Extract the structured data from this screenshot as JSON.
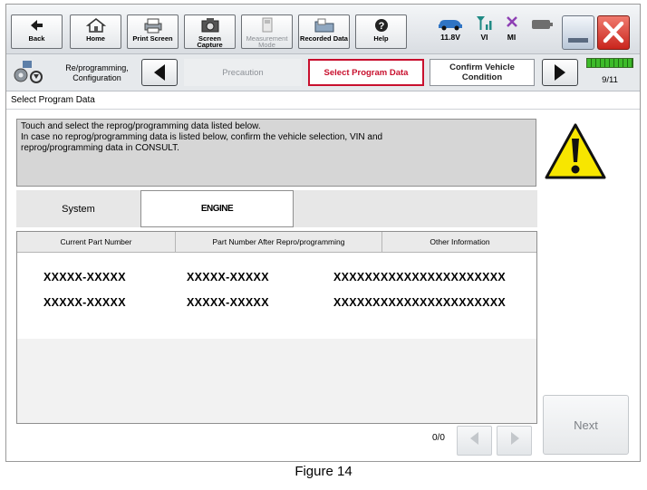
{
  "toolbar": {
    "back": "Back",
    "home": "Home",
    "print_screen": "Print Screen",
    "screen_capture": "Screen Capture",
    "measurement_mode": "Measurement Mode",
    "recorded_data": "Recorded Data",
    "help": "Help"
  },
  "status": {
    "voltage": "11.8V",
    "vi": "VI",
    "mi": "MI"
  },
  "nav": {
    "section": "Re/programming, Configuration",
    "steps": [
      "Precaution",
      "Select Program Data",
      "Confirm Vehicle Condition"
    ],
    "page": "9/11"
  },
  "page_title": "Select Program Data",
  "message": {
    "line1": "Touch and select the reprog/programming data listed below.",
    "line2": "In case no reprog/programming data is listed below, confirm the vehicle selection, VIN and",
    "line3": "reprog/programming data in CONSULT."
  },
  "system": {
    "label": "System",
    "value": "ENGINE"
  },
  "table": {
    "headers": [
      "Current Part Number",
      "Part Number After Repro/programming",
      "Other Information"
    ],
    "rows": [
      [
        "XXXXX-XXXXX",
        "XXXXX-XXXXX",
        "XXXXXXXXXXXXXXXXXXXXXX"
      ],
      [
        "XXXXX-XXXXX",
        "XXXXX-XXXXX",
        "XXXXXXXXXXXXXXXXXXXXXX"
      ]
    ]
  },
  "pager": {
    "count": "0/0"
  },
  "buttons": {
    "next": "Next"
  },
  "caption": "Figure 14",
  "colors": {
    "active_step": "#c8102e",
    "close_button": "#d9342b",
    "warning": "#f7e600"
  },
  "icons": [
    "back-arrow-icon",
    "home-icon",
    "printer-icon",
    "camera-icon",
    "meter-icon",
    "folder-icon",
    "help-icon",
    "car-icon",
    "signal-icon",
    "close-x-icon",
    "battery-icon",
    "window-icon",
    "gear-wrench-icon",
    "warning-icon"
  ]
}
